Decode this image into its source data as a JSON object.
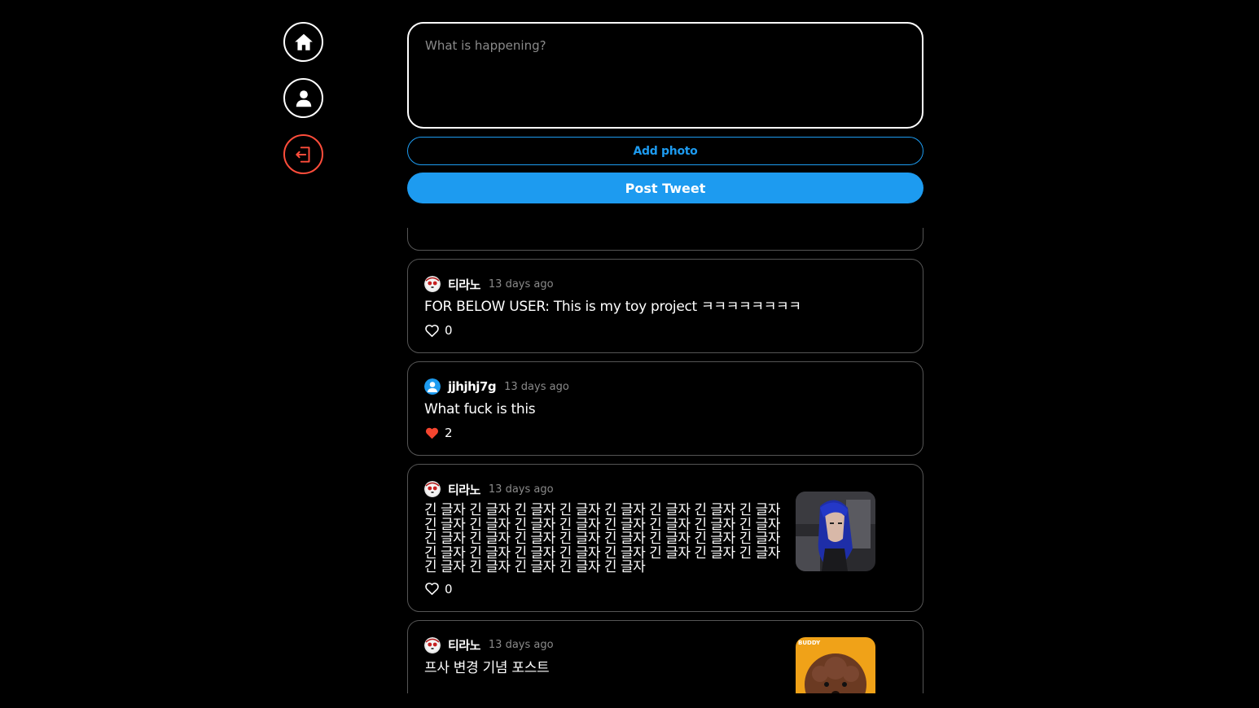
{
  "sidebar": {
    "items": [
      {
        "name": "home",
        "icon": "home-icon"
      },
      {
        "name": "profile",
        "icon": "user-icon"
      },
      {
        "name": "logout",
        "icon": "logout-icon",
        "color": "#ff4d3b"
      }
    ]
  },
  "compose": {
    "placeholder": "What is happening?",
    "add_photo_label": "Add photo",
    "post_label": "Post Tweet"
  },
  "colors": {
    "accent": "#1d9bf0",
    "like": "#f4452f",
    "muted": "#8a8a8a"
  },
  "tweets": [
    {
      "username": "티라노",
      "time": "13 days ago",
      "text": "FOR BELOW USER: This is my toy project ㅋㅋㅋㅋㅋㅋㅋㅋ",
      "likes": "0",
      "liked": false
    },
    {
      "username": "jjhjhj7g",
      "time": "13 days ago",
      "text": "What fuck is this",
      "likes": "2",
      "liked": true
    },
    {
      "username": "티라노",
      "time": "13 days ago",
      "text": "긴 글자 긴 글자 긴 글자 긴 글자 긴 글자 긴 글자 긴 글자 긴 글자 긴 글자 긴 글자 긴 글자 긴 글자 긴 글자 긴 글자 긴 글자 긴 글자 긴 글자 긴 글자 긴 글자 긴 글자 긴 글자 긴 글자 긴 글자 긴 글자 긴 글자 긴 글자 긴 글자 긴 글자 긴 글자 긴 글자 긴 글자 긴 글자 긴 글자 긴 글자 긴 글자 긴 글자 긴 글자",
      "likes": "0",
      "liked": false,
      "photo": "girl-blue-hair-photo"
    },
    {
      "username": "티라노",
      "time": "13 days ago",
      "text": "프사 변경 기념 포스트",
      "photo": "poodle-photo",
      "photo_caption": "BUDDY"
    }
  ]
}
